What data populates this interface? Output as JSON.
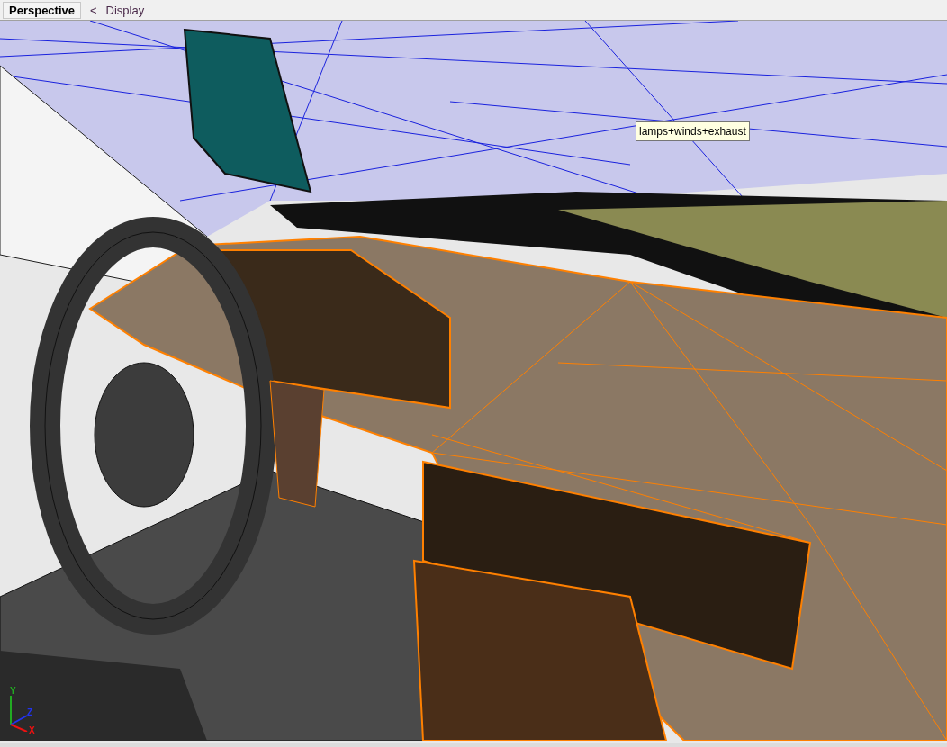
{
  "viewport": {
    "label": "Perspective",
    "menu_arrow": "<",
    "menu": "Display",
    "tooltip": "lamps+winds+exhaust",
    "axes": [
      {
        "label": "Y",
        "color": "#22aa22"
      },
      {
        "label": "Z",
        "color": "#2233ee"
      },
      {
        "label": "X",
        "color": "#ee1111"
      }
    ]
  }
}
